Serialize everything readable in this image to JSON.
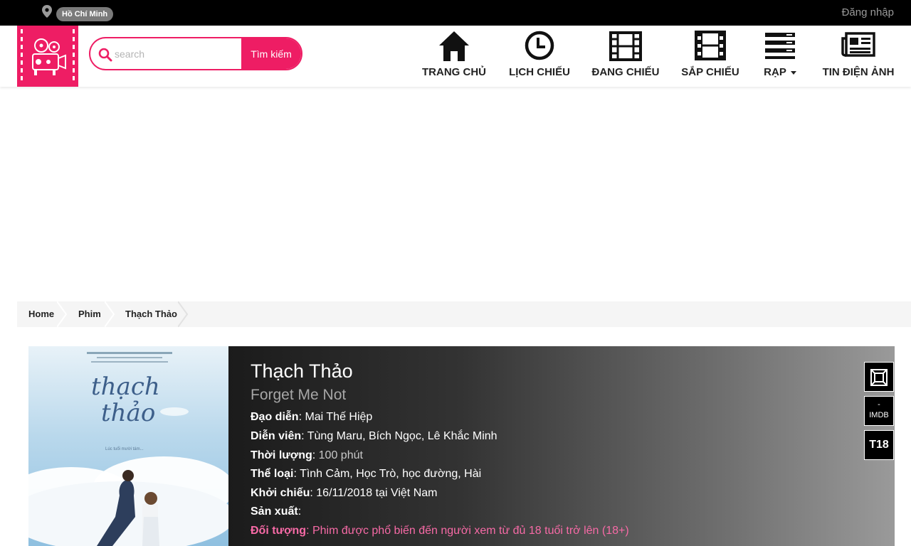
{
  "topbar": {
    "city": "Hồ Chí Minh",
    "login": "Đăng nhập"
  },
  "header": {
    "search_placeholder": "search",
    "search_button": "Tìm kiếm",
    "nav": {
      "home": "TRANG CHỦ",
      "schedule": "LỊCH CHIẾU",
      "now_showing": "ĐANG CHIẾU",
      "coming_soon": "SẮP CHIẾU",
      "cinema": "RẠP",
      "news": "TIN ĐIỆN ẢNH"
    }
  },
  "breadcrumb": [
    "Home",
    "Phim",
    "Thạch Thảo"
  ],
  "movie": {
    "title": "Thạch Thảo",
    "original_title": "Forget Me Not",
    "director_label": "Đạo diễn",
    "director": "Mai Thế Hiệp",
    "cast_label": "Diễn viên",
    "cast": "Tùng Maru, Bích Ngọc, Lê Khắc Minh",
    "duration_label": "Thời lượng",
    "duration": "100 phút",
    "genre_label": "Thể loại",
    "genre": "Tình Cảm, Học Trò, học đường, Hài",
    "release_label": "Khởi chiếu",
    "release": "16/11/2018 tại Việt Nam",
    "producer_label": "Sản xuất",
    "producer": "",
    "audience_label": "Đối tượng",
    "audience": "Phim được phổ biến đến người xem từ đủ 18 tuổi trở lên (18+)",
    "imdb_score": "-",
    "imdb_label": "IMDB",
    "rating": "T18",
    "poster_title_line1": "thạch",
    "poster_title_line2": "thảo",
    "poster_tagline": "Lúc tuổi mười tám..."
  },
  "colors": {
    "brand": "#ee1d64",
    "audience": "#f76aa6"
  },
  "icons": {
    "location": "map-pin-icon",
    "search": "search-icon",
    "home": "home-icon",
    "schedule": "clock-icon",
    "now_showing": "film-icon",
    "coming_soon": "film-strip-icon",
    "cinema": "list-icon",
    "news": "newspaper-icon",
    "gallery": "gallery-icon"
  }
}
